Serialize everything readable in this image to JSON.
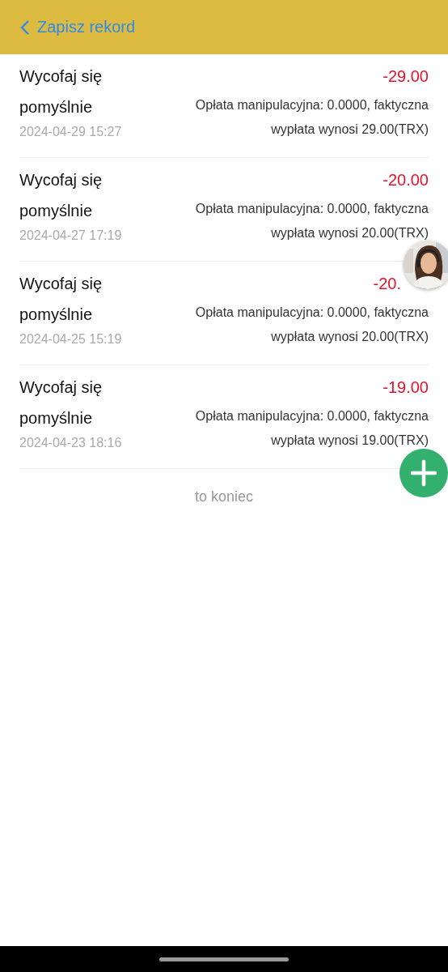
{
  "header": {
    "title": "Zapisz rekord"
  },
  "records": [
    {
      "title": "Wycofaj się pomyślnie",
      "time": "2024-04-29 15:27",
      "amount": "-29.00",
      "description": "Opłata manipulacyjna: 0.0000, faktyczna wypłata wynosi 29.00(TRX)"
    },
    {
      "title": "Wycofaj się pomyślnie",
      "time": "2024-04-27 17:19",
      "amount": "-20.00",
      "description": "Opłata manipulacyjna: 0.0000, faktyczna wypłata wynosi 20.00(TRX)"
    },
    {
      "title": "Wycofaj się pomyślnie",
      "time": "2024-04-25 15:19",
      "amount": "-20.",
      "amount_covered": true,
      "description": "Opłata manipulacyjna: 0.0000, faktyczna wypłata wynosi 20.00(TRX)"
    },
    {
      "title": "Wycofaj się pomyślnie",
      "time": "2024-04-23 18:16",
      "amount": "-19.00",
      "description": "Opłata manipulacyjna: 0.0000, faktyczna wypłata wynosi 19.00(TRX)"
    }
  ],
  "end_text": "to koniec"
}
